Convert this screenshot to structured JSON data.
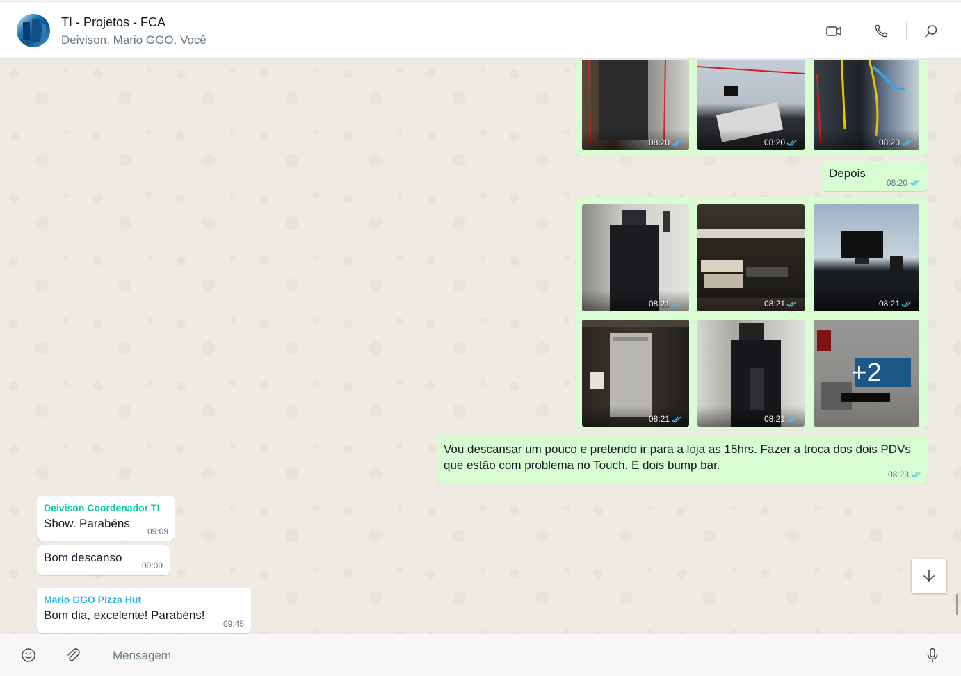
{
  "header": {
    "title": "TI - Projetos - FCA",
    "participants": "Deivison, Mario GGO, Você"
  },
  "messages": {
    "photo_group_1": {
      "times": [
        "08:20",
        "08:20",
        "08:20"
      ]
    },
    "depois": {
      "text": "Depois",
      "time": "08:20"
    },
    "photo_group_2": {
      "times": [
        "08:21",
        "08:21",
        "08:21",
        "08:21",
        "08:21"
      ],
      "more_label": "+2"
    },
    "long_msg": {
      "line1": "Vou descansar um pouco e pretendo ir para a loja as 15hrs. Fazer a troca dos dois PDVs",
      "line2": "que estão com problema no Touch. E dois bump bar.",
      "time": "08:23"
    },
    "deivison_1": {
      "sender": "Deivison Coordenador TI",
      "text": "Show. Parabéns",
      "time": "09:09"
    },
    "deivison_2": {
      "text": "Bom descanso",
      "time": "09:09"
    },
    "mario_1": {
      "sender": "Mario GGO Pizza Hut",
      "text": "Bom dia, excelente! Parabéns!",
      "time": "09:45"
    }
  },
  "composer": {
    "placeholder": "Mensagem"
  },
  "colors": {
    "outgoing_bubble": "#d9fdd3",
    "incoming_bubble": "#ffffff",
    "read_ticks": "#53bdeb",
    "sender_deivison": "#06cf9c",
    "sender_mario": "#35b3e0"
  },
  "icons": [
    "video-call-icon",
    "voice-call-icon",
    "search-icon",
    "emoji-icon",
    "attach-icon",
    "microphone-icon",
    "arrow-down-icon",
    "double-check-icon"
  ]
}
